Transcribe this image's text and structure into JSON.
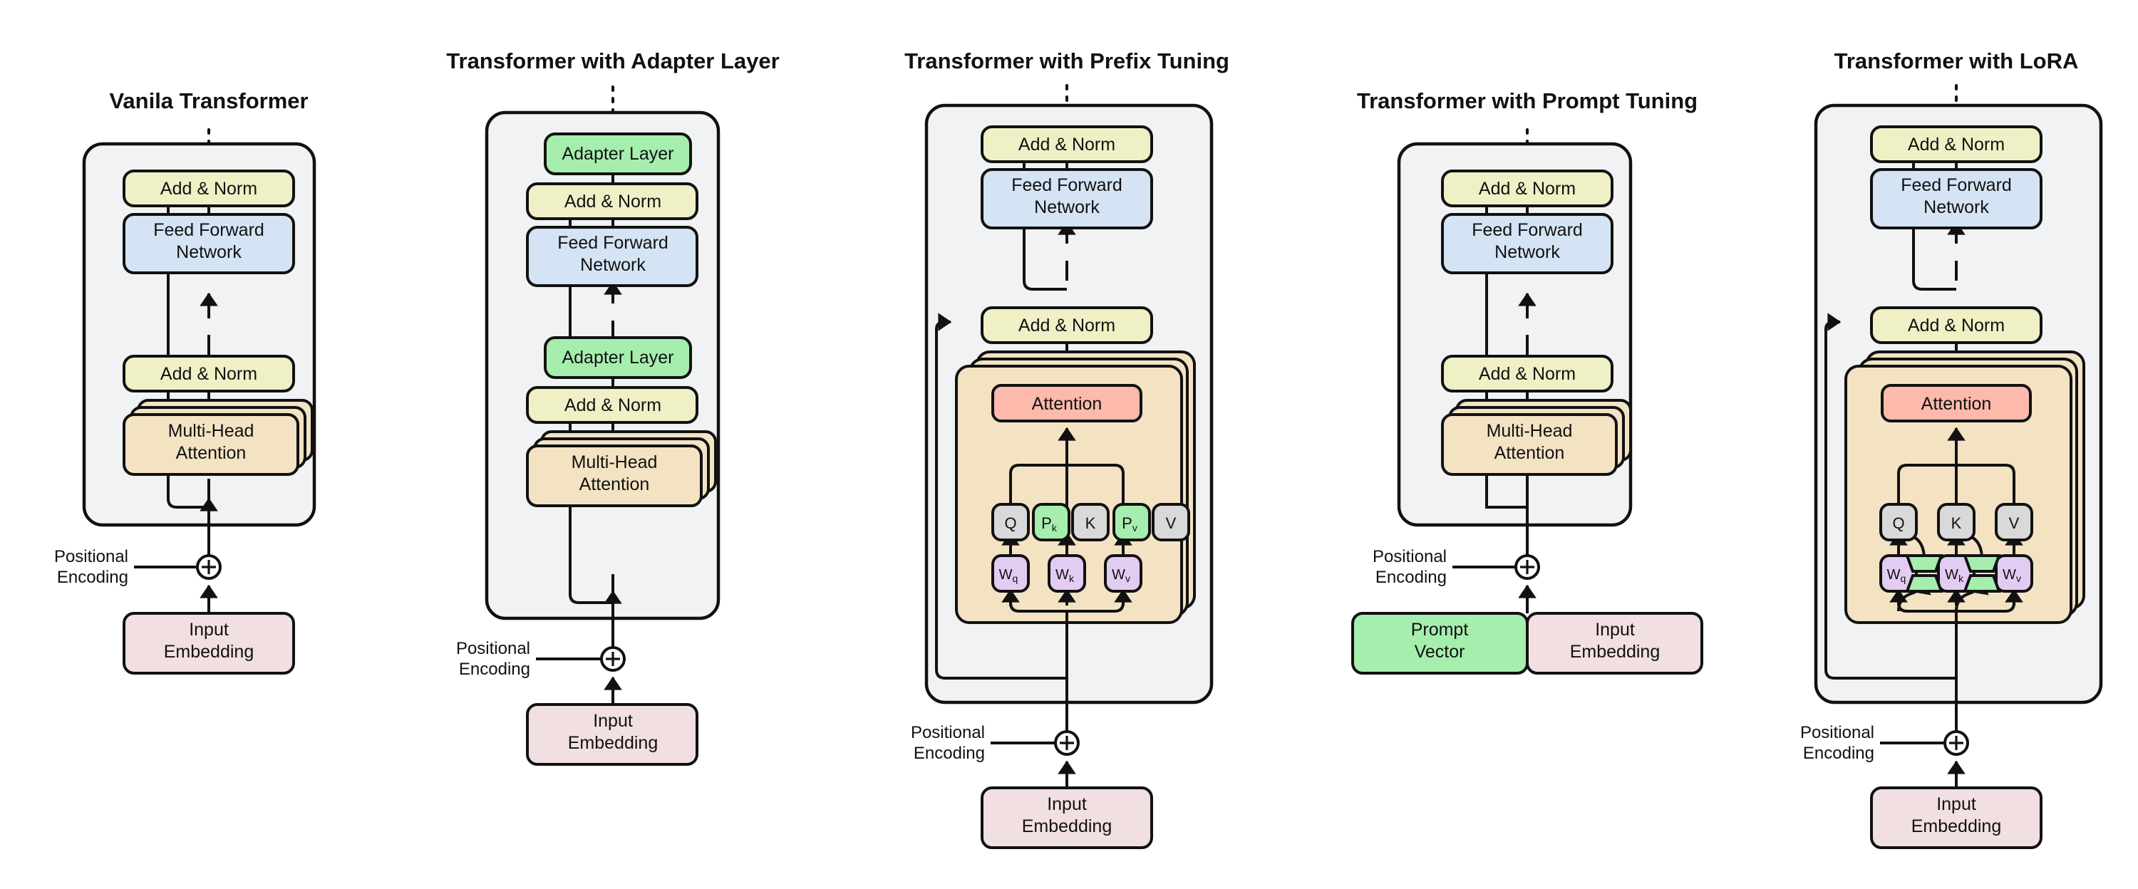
{
  "figure": {
    "type": "diagram",
    "subject": "Parameter-efficient fine-tuning variants of the Transformer architecture",
    "panel_count": 5
  },
  "colors": {
    "addnorm": "#f0f0c6",
    "ffn": "#d4e4f4",
    "attention_stack": "#f3e3c3",
    "attention_core": "#fcb9ac",
    "adapter_green": "#a6eeae",
    "input_embedding_pink": "#f2dfe2",
    "qkv_gray": "#d9d9d9",
    "weight_purple": "#e3ccf2",
    "outer_block": "#f1f2f4",
    "stroke": "#111111"
  },
  "panels": [
    {
      "id": "vanilla",
      "title": "Vanila Transformer",
      "nodes": {
        "add_norm_top": "Add & Norm",
        "ffn": "Feed Forward\nNetwork",
        "ffn_line1": "Feed Forward",
        "ffn_line2": "Network",
        "add_norm_bottom": "Add & Norm",
        "mha_line1": "Multi-Head",
        "mha_line2": "Attention",
        "pos_enc_line1": "Positional",
        "pos_enc_line2": "Encoding",
        "input_line1": "Input",
        "input_line2": "Embedding",
        "add_symbol": "+"
      }
    },
    {
      "id": "adapter",
      "title": "Transformer with Adapter Layer",
      "nodes": {
        "adapter_top": "Adapter Layer",
        "add_norm_top": "Add & Norm",
        "ffn_line1": "Feed Forward",
        "ffn_line2": "Network",
        "adapter_bottom": "Adapter Layer",
        "add_norm_bottom": "Add & Norm",
        "mha_line1": "Multi-Head",
        "mha_line2": "Attention",
        "pos_enc_line1": "Positional",
        "pos_enc_line2": "Encoding",
        "input_line1": "Input",
        "input_line2": "Embedding",
        "add_symbol": "+"
      }
    },
    {
      "id": "prefix",
      "title": "Transformer with Prefix Tuning",
      "nodes": {
        "add_norm_top": "Add & Norm",
        "ffn_line1": "Feed Forward",
        "ffn_line2": "Network",
        "add_norm_bottom": "Add & Norm",
        "attention": "Attention",
        "q": "Q",
        "pk_main": "P",
        "pk_sub": "k",
        "k": "K",
        "pv_main": "P",
        "pv_sub": "v",
        "v": "V",
        "wq_main": "W",
        "wq_sub": "q",
        "wk_main": "W",
        "wk_sub": "k",
        "wv_main": "W",
        "wv_sub": "v",
        "pos_enc_line1": "Positional",
        "pos_enc_line2": "Encoding",
        "input_line1": "Input",
        "input_line2": "Embedding",
        "add_symbol": "+"
      }
    },
    {
      "id": "prompt",
      "title": "Transformer with Prompt Tuning",
      "nodes": {
        "add_norm_top": "Add & Norm",
        "ffn_line1": "Feed Forward",
        "ffn_line2": "Network",
        "add_norm_bottom": "Add & Norm",
        "mha_line1": "Multi-Head",
        "mha_line2": "Attention",
        "pos_enc_line1": "Positional",
        "pos_enc_line2": "Encoding",
        "prompt_line1": "Prompt",
        "prompt_line2": "Vector",
        "input_line1": "Input",
        "input_line2": "Embedding",
        "add_symbol": "+"
      }
    },
    {
      "id": "lora",
      "title": "Transformer with LoRA",
      "nodes": {
        "add_norm_top": "Add & Norm",
        "ffn_line1": "Feed Forward",
        "ffn_line2": "Network",
        "add_norm_bottom": "Add & Norm",
        "attention": "Attention",
        "q": "Q",
        "k": "K",
        "v": "V",
        "wq_main": "W",
        "wq_sub": "q",
        "wk_main": "W",
        "wk_sub": "k",
        "wv_main": "W",
        "wv_sub": "v",
        "pos_enc_line1": "Positional",
        "pos_enc_line2": "Encoding",
        "input_line1": "Input",
        "input_line2": "Embedding",
        "add_symbol": "+"
      }
    }
  ]
}
